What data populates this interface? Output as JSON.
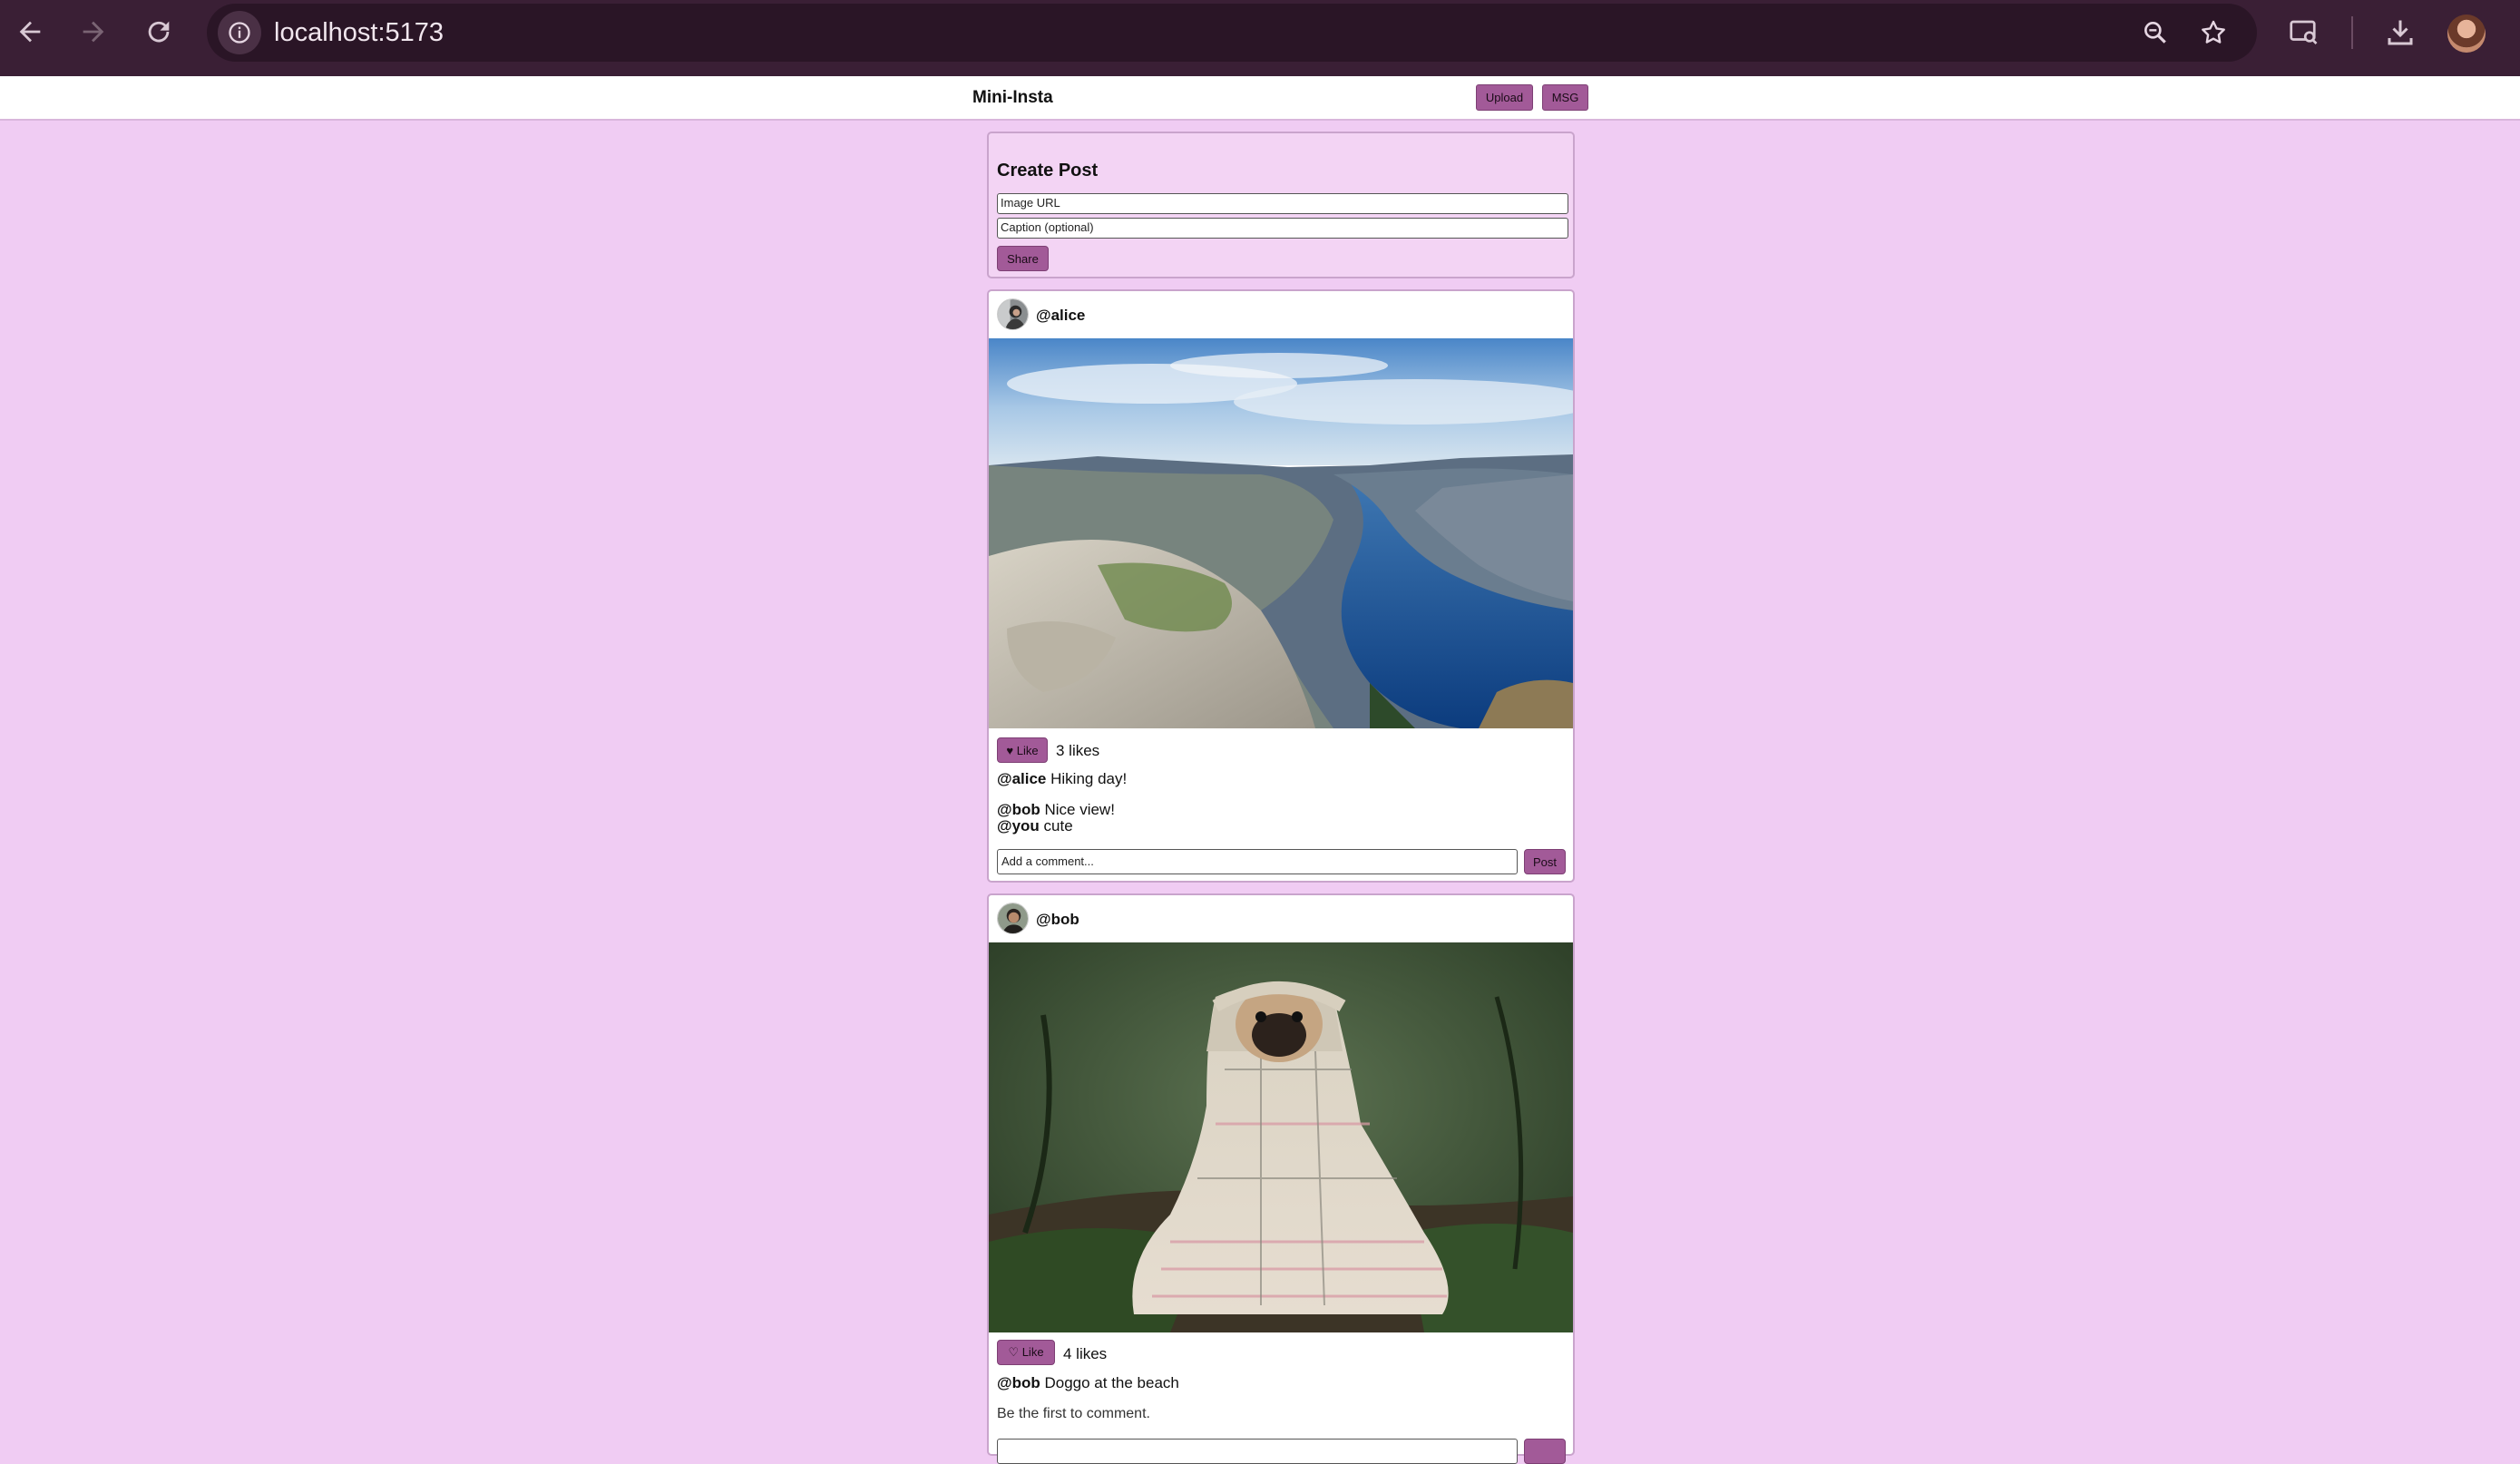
{
  "browser": {
    "url": "localhost:5173",
    "icons": {
      "back": "back-arrow-icon",
      "forward": "forward-arrow-icon",
      "reload": "reload-icon",
      "site_info": "info-icon",
      "zoom": "zoom-icon",
      "bookmark": "star-icon",
      "screen_search": "screen-search-icon",
      "downloads": "download-icon",
      "profile": "profile-avatar"
    }
  },
  "app": {
    "title": "Mini-Insta",
    "upload_label": "Upload",
    "msg_label": "MSG",
    "accent_color": "#a25a98",
    "background_color": "#f0ccf3"
  },
  "create_post": {
    "title": "Create Post",
    "image_url_placeholder": "Image URL",
    "caption_placeholder": "Caption (optional)",
    "share_label": "Share"
  },
  "posts": [
    {
      "username": "@alice",
      "image": "fjord-cliff-landscape",
      "like_label": "♥ Like",
      "likes": "3 likes",
      "caption_user": "@alice",
      "caption_text": "Hiking day!",
      "comments": [
        {
          "user": "@bob",
          "text": "Nice view!"
        },
        {
          "user": "@you",
          "text": "cute"
        }
      ],
      "comment_placeholder": "Add a comment...",
      "post_label": "Post"
    },
    {
      "username": "@bob",
      "image": "pug-in-blanket",
      "like_label": "♡ Like",
      "likes": "4 likes",
      "caption_user": "@bob",
      "caption_text": "Doggo at the beach",
      "empty_comments": "Be the first to comment."
    }
  ]
}
